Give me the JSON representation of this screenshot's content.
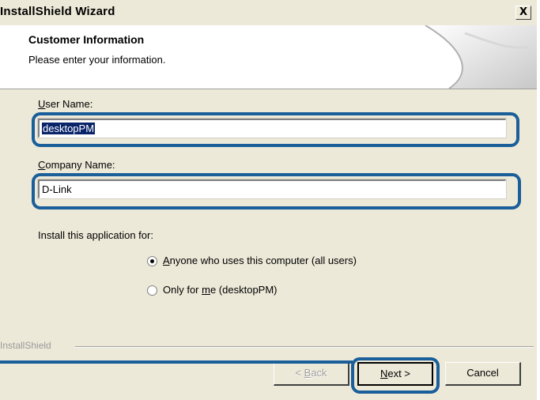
{
  "window": {
    "title": "InstallShield Wizard",
    "close_label": "X"
  },
  "header": {
    "title": "Customer Information",
    "subtitle": "Please enter your information."
  },
  "form": {
    "user_name": {
      "label_underlined": "U",
      "label_rest": "ser Name:",
      "value": "desktopPM"
    },
    "company_name": {
      "label_underlined": "C",
      "label_rest": "ompany Name:",
      "value": "D-Link"
    },
    "install_for_label": "Install this application for:",
    "options": [
      {
        "underlined": "A",
        "rest": "nyone who uses this computer (all users)",
        "checked": true
      },
      {
        "before": "Only for ",
        "underlined": "m",
        "rest": "e (desktopPM)",
        "checked": false
      }
    ]
  },
  "footer": {
    "brand": "InstallShield",
    "back_underlined": "B",
    "back_before": "< ",
    "back_rest": "ack",
    "next_underlined": "N",
    "next_rest": "ext >",
    "cancel_label": "Cancel"
  },
  "colors": {
    "dialog_bg": "#ece9d8",
    "callout_outline": "#1a5e9a",
    "selection": "#0a246a"
  }
}
